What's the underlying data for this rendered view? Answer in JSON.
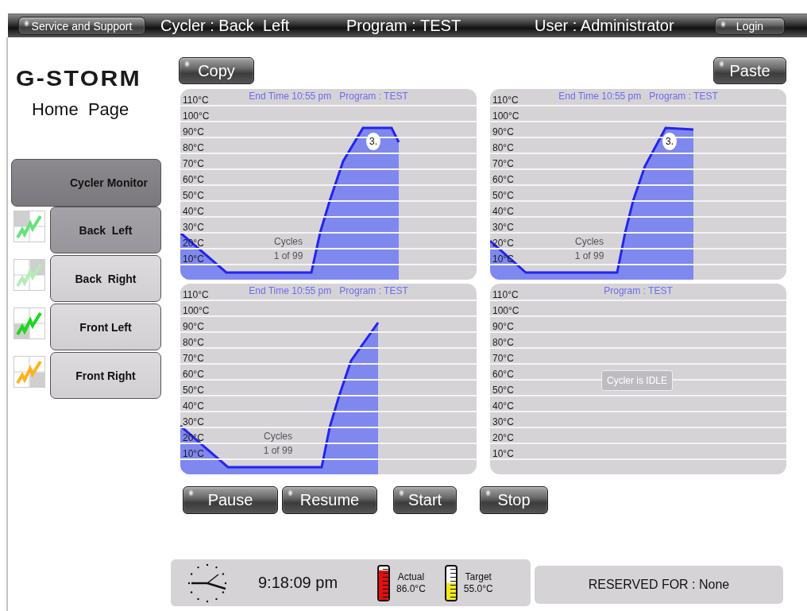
{
  "top_bar": {
    "service_button": "Service and Support",
    "cycler": "Cycler : Back  Left",
    "program": "Program : TEST",
    "user": "User : Administrator",
    "login_button": "Login"
  },
  "sidebar": {
    "logo": "G-STORM",
    "page_title": "Home  Page",
    "menu": {
      "label": "Cycler Monitor",
      "selected": true
    },
    "cyclers": [
      {
        "label": "Back  Left",
        "selected": true,
        "color": "#66e27a"
      },
      {
        "label": "Back  Right",
        "selected": false,
        "color": "#b4ecb8"
      },
      {
        "label": "Front Left",
        "selected": false,
        "color": "#1fd61f"
      },
      {
        "label": "Front Right",
        "selected": false,
        "color": "#ffb21e"
      }
    ]
  },
  "copy_button": "Copy",
  "paste_button": "Paste",
  "panels": [
    {
      "kind": "running",
      "title": "End Time 10:55 pm   Program : TEST",
      "y_ticks": [
        "110°C",
        "100°C",
        "90°C",
        "80°C",
        "70°C",
        "60°C",
        "50°C",
        "40°C",
        "30°C",
        "20°C",
        "10°C"
      ],
      "marker": "3.",
      "cycles_label": "Cycles",
      "cycles_count": "1 of 99"
    },
    {
      "kind": "running",
      "title": "End Time 10:55 pm   Program : TEST",
      "y_ticks": [
        "110°C",
        "100°C",
        "90°C",
        "80°C",
        "70°C",
        "60°C",
        "50°C",
        "40°C",
        "30°C",
        "20°C",
        "10°C"
      ],
      "marker": "3.",
      "cycles_label": "Cycles",
      "cycles_count": "1 of 99"
    },
    {
      "kind": "running",
      "title": "End Time 10:55 pm   Program : TEST",
      "y_ticks": [
        "110°C",
        "100°C",
        "90°C",
        "80°C",
        "70°C",
        "60°C",
        "50°C",
        "40°C",
        "30°C",
        "20°C",
        "10°C"
      ],
      "cycles_label": "Cycles",
      "cycles_count": "1 of 99"
    },
    {
      "kind": "idle",
      "title": "Program : TEST",
      "y_ticks": [
        "110°C",
        "100°C",
        "90°C",
        "80°C",
        "70°C",
        "60°C",
        "50°C",
        "40°C",
        "30°C",
        "20°C",
        "10°C"
      ],
      "status": "Cycler is IDLE"
    }
  ],
  "control_buttons": [
    "Pause",
    "Resume",
    "Start",
    "Stop"
  ],
  "status": {
    "time": "9:18:09 pm",
    "actual": {
      "label": "Actual",
      "reading": "86.0°C",
      "level": 0.88
    },
    "target": {
      "label": "Target",
      "reading": "55.0°C",
      "level": 0.5
    }
  },
  "reserved": "RESERVED FOR : None"
}
